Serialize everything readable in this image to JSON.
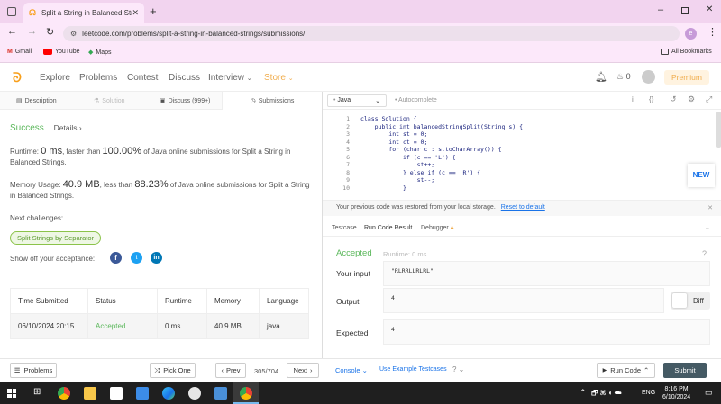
{
  "browser": {
    "tab_title": "Split a String in Balanced Strings",
    "url": "leetcode.com/problems/split-a-string-in-balanced-strings/submissions/",
    "bookmarks": [
      "Gmail",
      "YouTube",
      "Maps"
    ],
    "all_bookmarks": "All Bookmarks",
    "profile_initial": "e"
  },
  "nav": {
    "items": [
      "Explore",
      "Problems",
      "Contest",
      "Discuss",
      "Interview",
      "Store"
    ],
    "coins": "0",
    "premium": "Premium"
  },
  "tabs": {
    "description": "Description",
    "solution": "Solution",
    "discuss": "Discuss (999+)",
    "submissions": "Submissions"
  },
  "result": {
    "status": "Success",
    "details": "Details",
    "runtime_prefix": "Runtime: ",
    "runtime_value": "0 ms",
    "runtime_mid": ", faster than ",
    "runtime_pct": "100.00%",
    "runtime_suffix": " of Java online submissions for Split a String in Balanced Strings.",
    "memory_prefix": "Memory Usage: ",
    "memory_value": "40.9 MB",
    "memory_mid": ", less than ",
    "memory_pct": "88.23%",
    "memory_suffix": " of Java online submissions for Split a String in Balanced Strings.",
    "next_label": "Next challenges:",
    "next_challenge": "Split Strings by Separator",
    "share_label": "Show off your acceptance:"
  },
  "table": {
    "headers": [
      "Time Submitted",
      "Status",
      "Runtime",
      "Memory",
      "Language"
    ],
    "row": [
      "06/10/2024 20:15",
      "Accepted",
      "0 ms",
      "40.9 MB",
      "java"
    ]
  },
  "editor": {
    "language": "Java",
    "autocomplete": "Autocomplete",
    "line_numbers": [
      "1",
      "2",
      "3",
      "4",
      "5",
      "6",
      "7",
      "8",
      "9",
      "10"
    ],
    "lines": [
      "class Solution {",
      "    public int balancedStringSplit(String s) {",
      "        int st = 0;",
      "        int ct = 0;",
      "        for (char c : s.toCharArray()) {",
      "            if (c == 'L') {",
      "                st++;",
      "            } else if (c == 'R') {",
      "                st--;",
      "            }"
    ],
    "restore_msg": "Your previous code was restored from your local storage.",
    "reset_link": "Reset to default",
    "new_badge": "NEW"
  },
  "console": {
    "tabs": [
      "Testcase",
      "Run Code Result",
      "Debugger"
    ],
    "status": "Accepted",
    "runtime": "Runtime: 0 ms",
    "input_label": "Your input",
    "input_value": "\"RLRRLLRLRL\"",
    "output_label": "Output",
    "output_value": "4",
    "diff": "Diff",
    "expected_label": "Expected",
    "expected_value": "4"
  },
  "footer": {
    "problems": "Problems",
    "pick_one": "Pick One",
    "prev": "Prev",
    "page": "305/704",
    "next": "Next",
    "console": "Console",
    "example": "Use Example Testcases",
    "run": "Run Code",
    "submit": "Submit"
  },
  "taskbar": {
    "time": "8:16 PM",
    "date": "6/10/2024",
    "lang": "ENG"
  },
  "colors": {
    "green": "#5cb85c",
    "orange": "#f0ad4e",
    "blue": "#1a73e8",
    "accent": "#f2d4ef"
  }
}
